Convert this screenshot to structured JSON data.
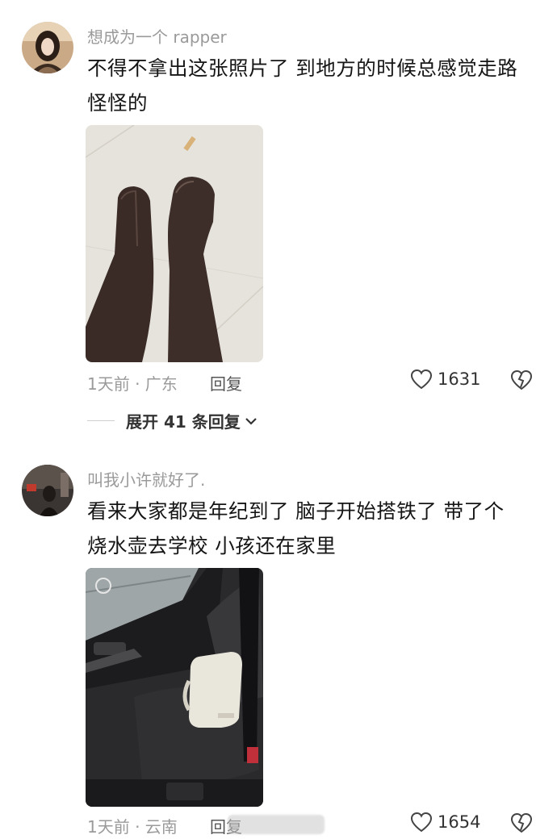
{
  "comments": [
    {
      "username": "想成为一个 rapper",
      "text_line1": "不得不拿出这张照片了 到地方的时候总感觉走路",
      "text_line2": "怪怪的",
      "time_location": "1天前 · 广东",
      "reply_label": "回复",
      "likes": "1631",
      "expand_label": "展开 41 条回复",
      "photo_icon": "photo-of-mismatched-boots"
    },
    {
      "username": "叫我小许就好了.",
      "text_line1": "看来大家都是年纪到了 脑子开始搭铁了 带了个",
      "text_line2": "烧水壶去学校 小孩还在家里",
      "time_location": "1天前 · 云南",
      "reply_label": "回复",
      "likes": "1654",
      "photo_icon": "photo-of-kettle-in-car-seat"
    }
  ],
  "colors": {
    "muted_text": "#9a9a9a",
    "main_text": "#151515",
    "icon": "#444444"
  }
}
